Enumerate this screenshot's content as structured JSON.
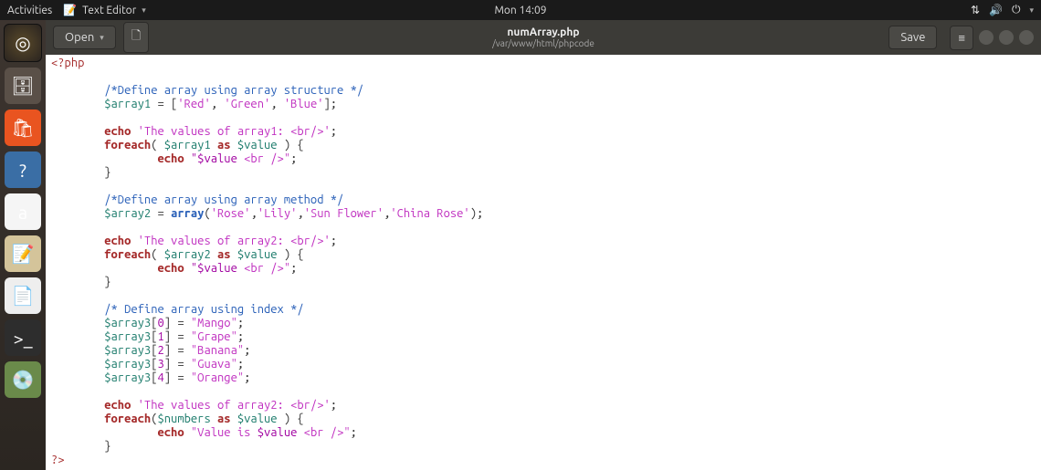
{
  "panel": {
    "activities": "Activities",
    "app_name": "Text Editor",
    "clock": "Mon 14:09"
  },
  "launcher": [
    {
      "name": "dash-icon",
      "glyph": "◎"
    },
    {
      "name": "files-icon",
      "glyph": "🗄"
    },
    {
      "name": "software-icon",
      "glyph": "🛍"
    },
    {
      "name": "help-icon",
      "glyph": "?"
    },
    {
      "name": "amazon-icon",
      "glyph": "a"
    },
    {
      "name": "notes-icon",
      "glyph": "📝"
    },
    {
      "name": "document-icon",
      "glyph": "📄"
    },
    {
      "name": "terminal-icon",
      "glyph": ">_"
    },
    {
      "name": "disk-analyzer-icon",
      "glyph": "💿"
    }
  ],
  "headerbar": {
    "open": "Open",
    "title": "numArray.php",
    "subtitle": "/var/www/html/phpcode",
    "save": "Save"
  },
  "code": {
    "open_tag": "<?php",
    "cmt1": "/*Define array using array structure */",
    "arr1_var": "$array1",
    "arr1_vals": [
      "'Red'",
      "'Green'",
      "'Blue'"
    ],
    "echo1_str": "'The values of array1: <br/>'",
    "fe1_arr": "$array1",
    "fe1_val": "$value",
    "echo1b_a": "\"$value",
    "echo1b_b": " <br />\"",
    "cmt2": "/*Define array using array method */",
    "arr2_var": "$array2",
    "arr2_func": "array",
    "arr2_vals": [
      "'Rose'",
      "'Lily'",
      "'Sun Flower'",
      "'China Rose'"
    ],
    "echo2_str": "'The values of array2: <br/>'",
    "fe2_arr": "$array2",
    "fe2_val": "$value",
    "echo2b_a": "\"$value",
    "echo2b_b": " <br />\"",
    "cmt3": "/* Define array using index */",
    "arr3_var": "$array3",
    "idx": [
      "0",
      "1",
      "2",
      "3",
      "4"
    ],
    "idx_vals": [
      "\"Mango\"",
      "\"Grape\"",
      "\"Banana\"",
      "\"Guava\"",
      "\"Orange\""
    ],
    "echo3_str": "'The values of array2: <br/>'",
    "fe3_arr": "$numbers",
    "fe3_val": "$value",
    "echo3b_a": "\"Value is ",
    "echo3b_b": "$value",
    "echo3b_c": " <br />\"",
    "close_tag": "?>",
    "kw_echo": "echo",
    "kw_foreach": "foreach",
    "kw_as": "as"
  }
}
